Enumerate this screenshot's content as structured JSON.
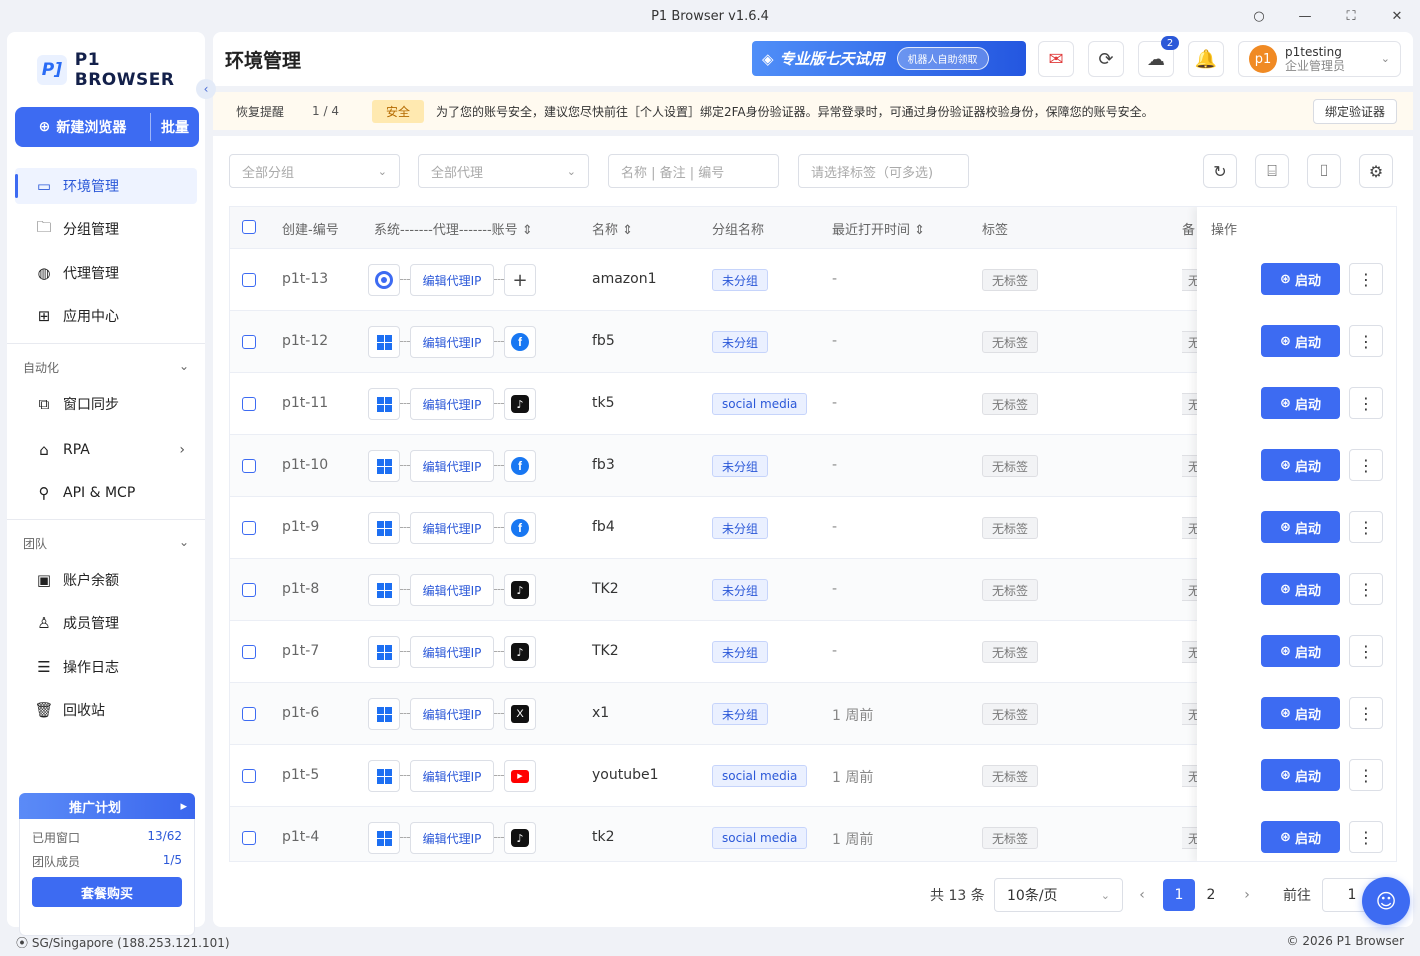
{
  "window": {
    "title": "P1 Browser v1.6.4"
  },
  "brand": {
    "logo_mark": "P]",
    "name": "P1 BROWSER"
  },
  "sidebar": {
    "new_browser": "新建浏览器",
    "batch": "批量",
    "items": [
      {
        "label": "环境管理",
        "icon": "window-icon",
        "active": true
      },
      {
        "label": "分组管理",
        "icon": "folder-icon"
      },
      {
        "label": "代理管理",
        "icon": "globe-icon"
      },
      {
        "label": "应用中心",
        "icon": "grid-icon"
      }
    ],
    "automation_title": "自动化",
    "automation_items": [
      {
        "label": "窗口同步",
        "icon": "sync-window-icon"
      },
      {
        "label": "RPA",
        "icon": "robot-icon"
      },
      {
        "label": "API & MCP",
        "icon": "plug-icon"
      }
    ],
    "team_title": "团队",
    "team_items": [
      {
        "label": "账户余额",
        "icon": "wallet-icon"
      },
      {
        "label": "成员管理",
        "icon": "users-icon"
      },
      {
        "label": "操作日志",
        "icon": "log-icon"
      },
      {
        "label": "回收站",
        "icon": "trash-icon"
      }
    ],
    "promo": {
      "title": "推广计划",
      "used_windows_label": "已用窗口",
      "used_windows_value": "13/62",
      "team_members_label": "团队成员",
      "team_members_value": "1/5",
      "buy_label": "套餐购买"
    }
  },
  "status": {
    "location": "SG/Singapore (188.253.121.101)",
    "copyright": "© 2026 P1 Browser"
  },
  "header": {
    "title": "环境管理",
    "trial_text": "专业版七天试用",
    "trial_pill": "机器人自助领取",
    "download_badge": "2",
    "user_name": "p1testing",
    "user_role": "企业管理员",
    "avatar_text": "p1"
  },
  "alert": {
    "label": "恢复提醒",
    "count": "1 / 4",
    "tag": "安全",
    "message": "为了您的账号安全，建议您尽快前往［个人设置］绑定2FA身份验证器。异常登录时，可通过身份验证器校验身份，保障您的账号安全。",
    "bind_button": "绑定验证器"
  },
  "filters": {
    "group": "全部分组",
    "proxy": "全部代理",
    "search_placeholder": "名称 | 备注 | 编号",
    "tags_placeholder": "请选择标签（可多选)"
  },
  "table": {
    "headers": {
      "code": "创建-编号",
      "system": "系统-------代理-------账号",
      "name": "名称",
      "group": "分组名称",
      "opened": "最近打开时间",
      "tags": "标签",
      "remark": "备",
      "ops": "操作"
    },
    "proxy_label": "编辑代理IP",
    "start_label": "启动",
    "no_tag": "无标签",
    "remark_char": "无",
    "rows": [
      {
        "code": "p1t-13",
        "sys": "chrome",
        "acc": "plus",
        "name": "amazon1",
        "group": "未分组",
        "opened": "-"
      },
      {
        "code": "p1t-12",
        "sys": "windows",
        "acc": "facebook",
        "name": "fb5",
        "group": "未分组",
        "opened": "-"
      },
      {
        "code": "p1t-11",
        "sys": "windows",
        "acc": "tiktok",
        "name": "tk5",
        "group": "social media",
        "opened": "-"
      },
      {
        "code": "p1t-10",
        "sys": "windows",
        "acc": "facebook",
        "name": "fb3",
        "group": "未分组",
        "opened": "-"
      },
      {
        "code": "p1t-9",
        "sys": "windows",
        "acc": "facebook",
        "name": "fb4",
        "group": "未分组",
        "opened": "-"
      },
      {
        "code": "p1t-8",
        "sys": "windows",
        "acc": "tiktok",
        "name": "TK2",
        "group": "未分组",
        "opened": "-"
      },
      {
        "code": "p1t-7",
        "sys": "windows",
        "acc": "tiktok",
        "name": "TK2",
        "group": "未分组",
        "opened": "-"
      },
      {
        "code": "p1t-6",
        "sys": "windows",
        "acc": "x",
        "name": "x1",
        "group": "未分组",
        "opened": "1 周前"
      },
      {
        "code": "p1t-5",
        "sys": "windows",
        "acc": "youtube",
        "name": "youtube1",
        "group": "social media",
        "opened": "1 周前"
      },
      {
        "code": "p1t-4",
        "sys": "windows",
        "acc": "tiktok",
        "name": "tk2",
        "group": "social media",
        "opened": "1 周前"
      }
    ]
  },
  "pagination": {
    "total": "共 13 条",
    "page_size": "10条/页",
    "pages": [
      "1",
      "2"
    ],
    "current": "1",
    "goto_label": "前往",
    "goto_value": "1"
  },
  "colors": {
    "accent": "#3d6bf2",
    "warning_bg": "#fffaf0"
  }
}
